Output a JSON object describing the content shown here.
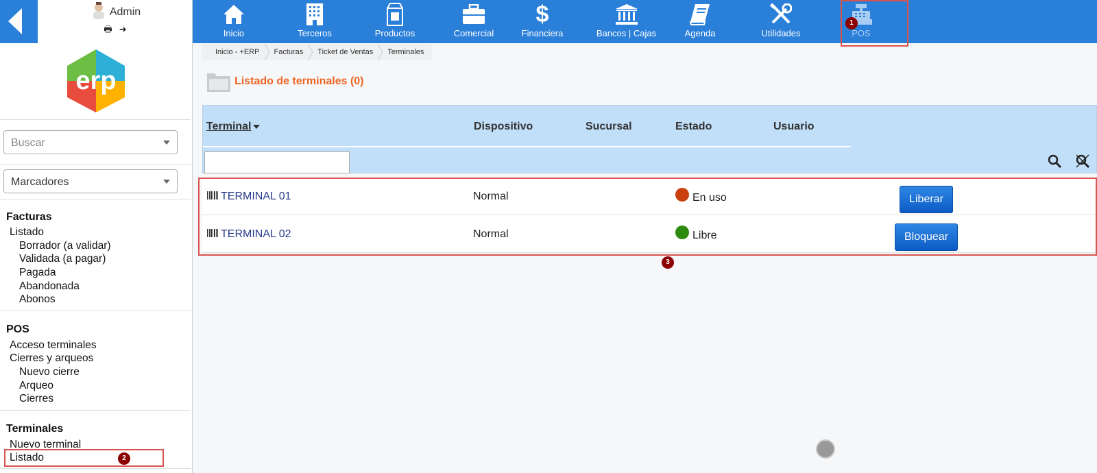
{
  "user": {
    "name": "Admin"
  },
  "sidebar": {
    "search_placeholder": "Buscar",
    "bookmarks_label": "Marcadores",
    "sections": [
      {
        "title": "Facturas",
        "items": [
          {
            "label": "Listado"
          },
          {
            "label": "Borrador (a validar)"
          },
          {
            "label": "Validada (a pagar)"
          },
          {
            "label": "Pagada"
          },
          {
            "label": "Abandonada"
          },
          {
            "label": "Abonos"
          }
        ]
      },
      {
        "title": "POS",
        "items": [
          {
            "label": "Acceso terminales"
          },
          {
            "label": "Cierres y arqueos"
          },
          {
            "label": "Nuevo cierre"
          },
          {
            "label": "Arqueo"
          },
          {
            "label": "Cierres"
          }
        ]
      },
      {
        "title": "Terminales",
        "items": [
          {
            "label": "Nuevo terminal"
          },
          {
            "label": "Listado"
          }
        ]
      }
    ]
  },
  "nav": {
    "items": [
      {
        "label": "Inicio",
        "icon": "home-icon"
      },
      {
        "label": "Terceros",
        "icon": "building-icon"
      },
      {
        "label": "Productos",
        "icon": "products-icon"
      },
      {
        "label": "Comercial",
        "icon": "briefcase-icon"
      },
      {
        "label": "Financiera",
        "icon": "dollar-icon"
      },
      {
        "label": "Bancos | Cajas",
        "icon": "bank-icon"
      },
      {
        "label": "Agenda",
        "icon": "book-icon"
      },
      {
        "label": "Utilidades",
        "icon": "tools-icon"
      },
      {
        "label": "POS",
        "icon": "cash-register-icon",
        "active": true
      }
    ]
  },
  "breadcrumb": [
    "Inicio - +ERP",
    "Facturas",
    "Ticket de Ventas",
    "Terminales"
  ],
  "page": {
    "title": "Listado de terminales (0)"
  },
  "table": {
    "headers": {
      "terminal": "Terminal",
      "device": "Dispositivo",
      "branch": "Sucursal",
      "state": "Estado",
      "user": "Usuario"
    },
    "rows": [
      {
        "terminal": "TERMINAL 01",
        "device": "Normal",
        "state": "En uso",
        "state_color": "#c9400e",
        "action": "Liberar"
      },
      {
        "terminal": "TERMINAL 02",
        "device": "Normal",
        "state": "Libre",
        "state_color": "#2e8b0e",
        "action": "Bloquear"
      }
    ]
  },
  "annotations": {
    "m1": "1",
    "m2": "2",
    "m3": "3"
  },
  "colors": {
    "nav_bg": "#2a7fd9",
    "title": "#f06423",
    "header_bg": "#c2dff9",
    "marker": "#8b0000",
    "highlight": "#d9534f"
  }
}
